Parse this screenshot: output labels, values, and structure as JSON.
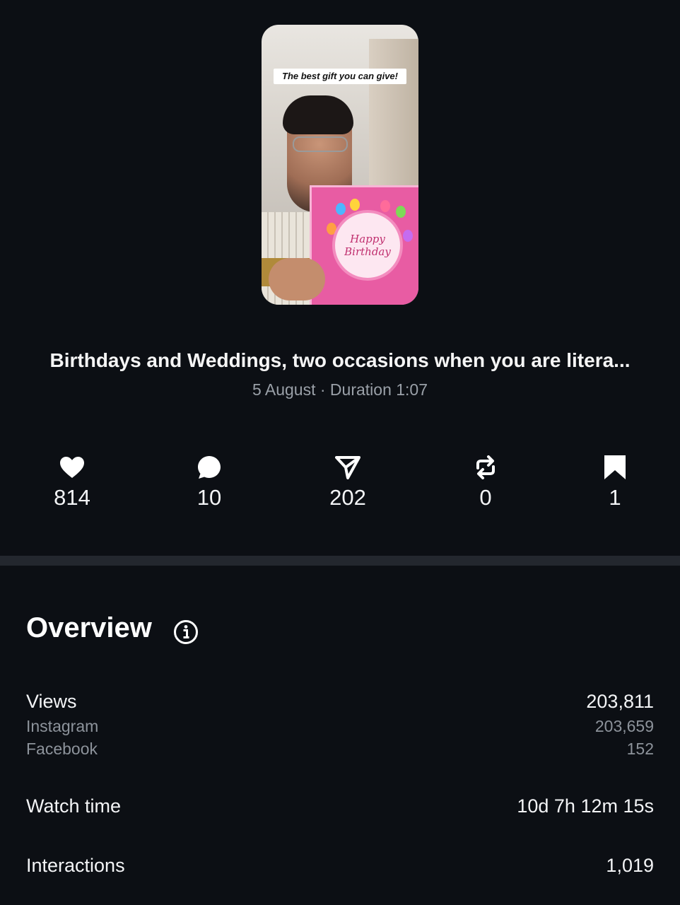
{
  "thumbnail": {
    "caption": "The best gift you can give!",
    "card_text_line1": "Happy",
    "card_text_line2": "Birthday"
  },
  "post": {
    "title": "Birthdays and Weddings, two occasions when you are litera...",
    "meta": "5 August · Duration 1:07"
  },
  "stats": {
    "likes": "814",
    "comments": "10",
    "shares": "202",
    "reposts": "0",
    "saves": "1"
  },
  "overview": {
    "title": "Overview",
    "views": {
      "label": "Views",
      "value": "203,811"
    },
    "instagram": {
      "label": "Instagram",
      "value": "203,659"
    },
    "facebook": {
      "label": "Facebook",
      "value": "152"
    },
    "watch_time": {
      "label": "Watch time",
      "value": "10d 7h 12m 15s"
    },
    "interactions": {
      "label": "Interactions",
      "value": "1,019"
    }
  },
  "icons": [
    "heart-icon",
    "comment-icon",
    "share-icon",
    "repost-icon",
    "bookmark-icon",
    "info-icon"
  ],
  "colors": {
    "background": "#0c0f14",
    "divider": "#23272e",
    "muted_text": "#8d939b"
  }
}
